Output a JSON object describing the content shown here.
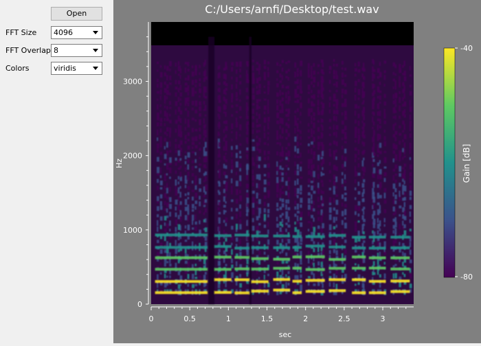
{
  "controls": {
    "open_label": "Open",
    "fft_size": {
      "label": "FFT Size",
      "value": "4096"
    },
    "fft_overlap": {
      "label": "FFT Overlap",
      "value": "8"
    },
    "colors": {
      "label": "Colors",
      "value": "viridis"
    }
  },
  "colors": {
    "plot_background": "#808080",
    "panel_background": "#f0f0f0",
    "colormap": [
      "#440154",
      "#3b528b",
      "#21918c",
      "#5ec962",
      "#fde725"
    ]
  },
  "chart_data": {
    "type": "heatmap",
    "title": "C:/Users/arnfi/Desktop/test.wav",
    "xlabel": "sec",
    "ylabel": "Hz",
    "xlim": [
      0,
      3.4
    ],
    "ylim": [
      0,
      3800
    ],
    "xticks": [
      0,
      0.5,
      1,
      1.5,
      2,
      2.5,
      3
    ],
    "xtick_labels": [
      "0",
      "0.5",
      "1",
      "1.5",
      "2",
      "2.5",
      "3"
    ],
    "yticks": [
      0,
      1000,
      2000,
      3000
    ],
    "ytick_labels": [
      "0",
      "1000",
      "2000",
      "3000"
    ],
    "colorbar": {
      "label": "Gain [dB]",
      "min": -80,
      "max": -40,
      "tick_labels": [
        "-40",
        "-80"
      ]
    }
  }
}
